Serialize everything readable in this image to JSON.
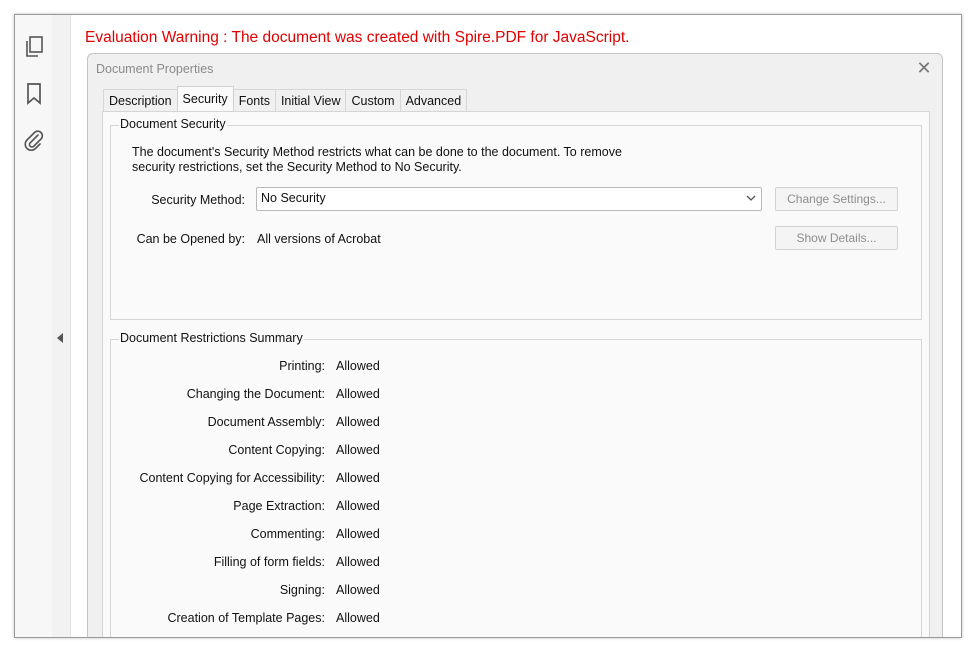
{
  "warning_text": "Evaluation Warning : The document was created with Spire.PDF for JavaScript.",
  "sidebar": {
    "icons": [
      "copy-pages-icon",
      "bookmark-icon",
      "paperclip-icon"
    ]
  },
  "dialog": {
    "title": "Document Properties",
    "tabs": [
      "Description",
      "Security",
      "Fonts",
      "Initial View",
      "Custom",
      "Advanced"
    ],
    "active_tab": "Security",
    "security": {
      "group_title": "Document Security",
      "description_line1": "The document's Security Method restricts what can be done to the document. To remove",
      "description_line2": "security restrictions, set the Security Method to No Security.",
      "method_label": "Security Method:",
      "method_value": "No Security",
      "change_settings": "Change Settings...",
      "opened_by_label": "Can be Opened by:",
      "opened_by_value": "All versions of Acrobat",
      "show_details": "Show Details..."
    },
    "restrictions": {
      "group_title": "Document Restrictions Summary",
      "items": [
        {
          "label": "Printing:",
          "value": "Allowed"
        },
        {
          "label": "Changing the Document:",
          "value": "Allowed"
        },
        {
          "label": "Document Assembly:",
          "value": "Allowed"
        },
        {
          "label": "Content Copying:",
          "value": "Allowed"
        },
        {
          "label": "Content Copying for Accessibility:",
          "value": "Allowed"
        },
        {
          "label": "Page Extraction:",
          "value": "Allowed"
        },
        {
          "label": "Commenting:",
          "value": "Allowed"
        },
        {
          "label": "Filling of form fields:",
          "value": "Allowed"
        },
        {
          "label": "Signing:",
          "value": "Allowed"
        },
        {
          "label": "Creation of Template Pages:",
          "value": "Allowed"
        }
      ]
    }
  }
}
